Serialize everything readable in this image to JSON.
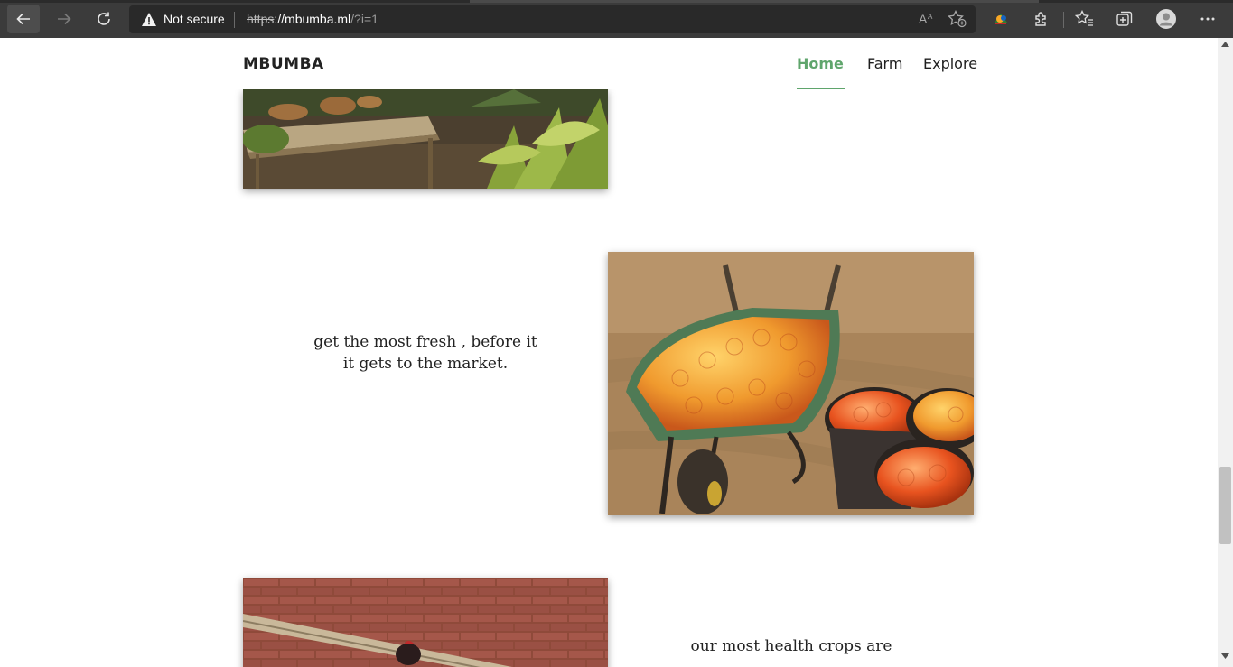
{
  "browser": {
    "security_label": "Not secure",
    "url_scheme": "https",
    "url_host": "://mbumba.ml",
    "url_query": "/?i=1",
    "toolbar_icons": [
      "back-icon",
      "forward-icon",
      "reload-icon",
      "read-aloud-icon",
      "add-favorite-icon",
      "extension-badge-icon",
      "extensions-icon",
      "favorites-icon",
      "collections-icon",
      "profile-avatar-icon",
      "more-menu-icon"
    ]
  },
  "site": {
    "brand": "MBUMBA",
    "nav": {
      "home": "Home",
      "farm": "Farm",
      "explore": "Explore",
      "active": "Home",
      "active_color": "#5fa56c"
    }
  },
  "sections": {
    "fresh_caption": "get the most fresh , before it it gets to the market.",
    "health_caption": "our most health crops are"
  },
  "images": [
    "market-table-photo",
    "tomato-wheelbarrow-photo",
    "chicken-brick-wall-photo"
  ],
  "scrollbar": {
    "position_fraction": 0.7
  }
}
